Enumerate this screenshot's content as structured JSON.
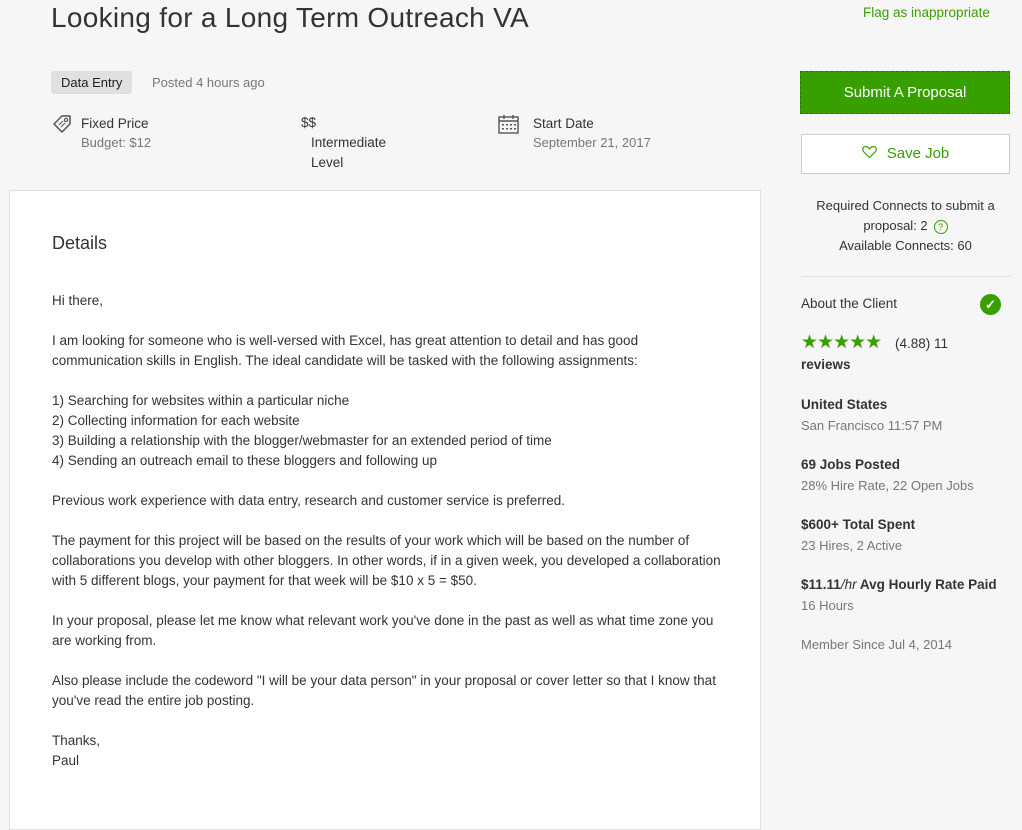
{
  "job": {
    "title": "Looking for a Long Term Outreach VA",
    "flag_label": "Flag as inappropriate",
    "category": "Data Entry",
    "posted": "Posted 4 hours ago",
    "type_label": "Fixed Price",
    "budget": "Budget: $12",
    "level_symbol": "$$",
    "level_line1": "Intermediate",
    "level_line2": "Level",
    "start_label": "Start Date",
    "start_date": "September 21, 2017"
  },
  "details": {
    "heading": "Details",
    "paragraphs": [
      "Hi there,",
      "I am looking for someone who is well-versed with Excel, has great attention to detail and has good communication skills in English. The ideal candidate will be tasked with the following assignments:",
      "1) Searching for websites within a particular niche",
      "2) Collecting information for each website",
      "3) Building a relationship with the blogger/webmaster for an extended period of time",
      "4) Sending an outreach email to these bloggers and following up",
      "Previous work experience with data entry, research and customer service is preferred.",
      "The payment for this project will be based on the results of your work which will be based on the number of collaborations you develop with other bloggers. In other words, if in a given week, you developed a collaboration with 5 different blogs, your payment for that week will be $10 x 5 = $50.",
      "In your proposal, please let me know what relevant work you've done in the past as well as what time zone you are working from.",
      "Also please include the codeword \"I will be your data person\" in your proposal or cover letter so that I know that you've read the entire job posting.",
      "Thanks,",
      "Paul"
    ]
  },
  "sidebar": {
    "submit_label": "Submit A Proposal",
    "save_label": "Save Job",
    "connects_line1": "Required Connects to submit a",
    "connects_line2": "proposal: 2",
    "connects_line3": "Available Connects: 60",
    "help_glyph": "?",
    "about_label": "About the Client",
    "verified_glyph": "✓",
    "stars": "★★★★★",
    "rating": "(4.88) 11",
    "reviews": "reviews",
    "country": "United States",
    "city_time": "San Francisco 11:57 PM",
    "jobs_posted": "69 Jobs Posted",
    "hire_rate": "28% Hire Rate, 22 Open Jobs",
    "total_spent": "$600+ Total Spent",
    "hires": "23 Hires, 2 Active",
    "hourly_rate_amount": "$11.11",
    "hourly_rate_unit": "/hr",
    "hourly_rate_label": " Avg Hourly Rate Paid",
    "hours": "16 Hours",
    "member_since": "Member Since Jul 4, 2014"
  },
  "colors": {
    "accent": "#37a000",
    "background": "#f6f6f6"
  },
  "icons": [
    "tag-icon",
    "calendar-icon",
    "heart-icon",
    "help-icon",
    "verified-check-icon",
    "star-icon"
  ]
}
